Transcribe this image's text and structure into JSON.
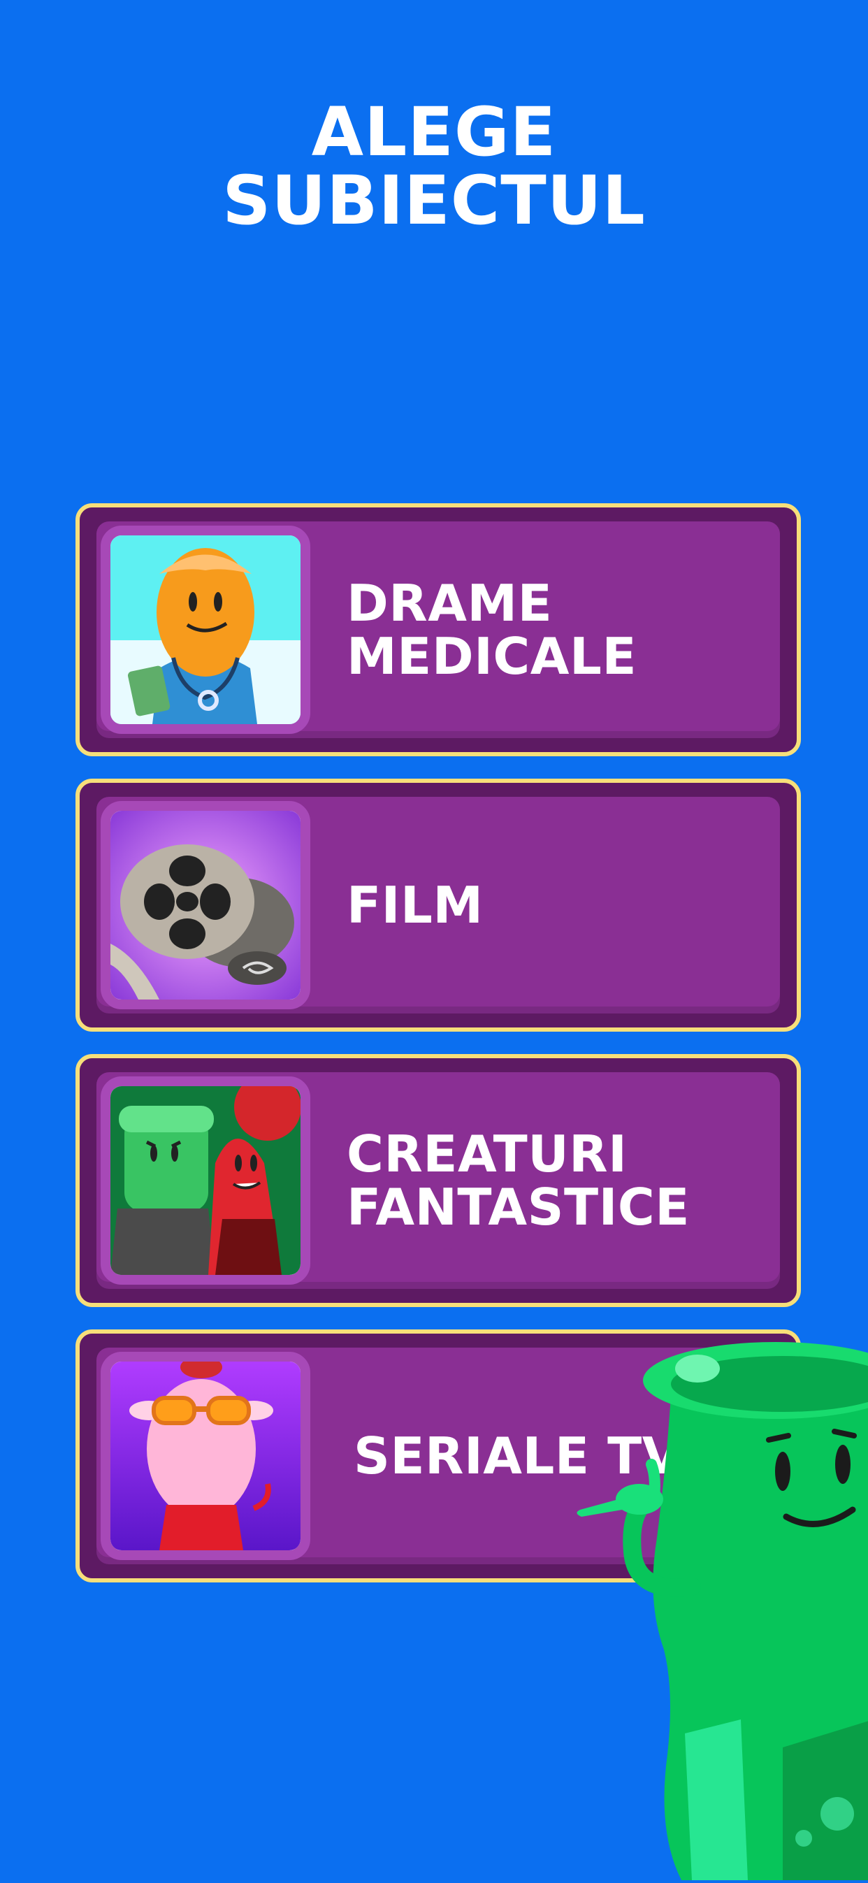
{
  "screen": {
    "title_line1": "ALEGE",
    "title_line2": "SUBIECTUL"
  },
  "topics": [
    {
      "line1": "DRAME",
      "line2": "MEDICALE",
      "icon": "doctor-character-icon"
    },
    {
      "line1": "FILM",
      "line2": "",
      "icon": "film-reel-icon"
    },
    {
      "line1": "CREATURI",
      "line2": "FANTASTICE",
      "icon": "monster-vampire-icon"
    },
    {
      "line1": "SERIALE TV",
      "line2": "",
      "icon": "turkey-sunglasses-icon"
    }
  ],
  "colors": {
    "background": "#0b6ff0",
    "card_outer": "#5d1a63",
    "card_inner": "#8a2f94",
    "card_border": "#f7df7a",
    "thumb_frame": "#a749b7",
    "mascot_green": "#07c55a"
  },
  "mascot": {
    "icon": "green-jar-mascot-icon"
  }
}
